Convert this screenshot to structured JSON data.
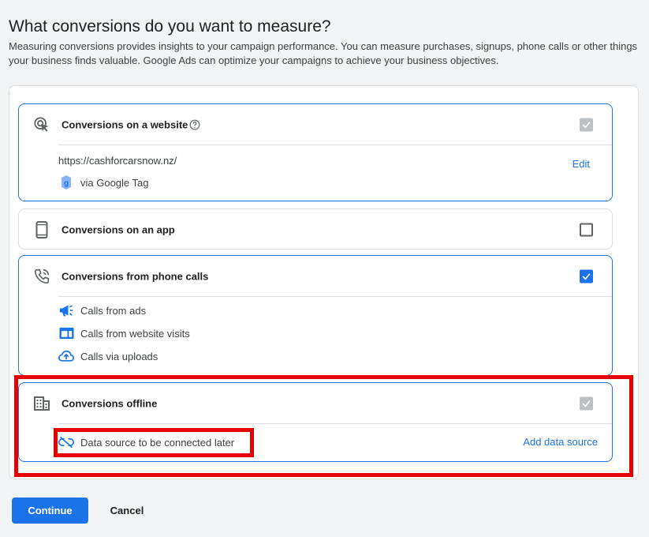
{
  "header": {
    "title": "What conversions do you want to measure?",
    "description": "Measuring conversions provides insights to your campaign performance. You can measure purchases, signups, phone calls or other things your business finds valuable. Google Ads can optimize your campaigns to achieve your business objectives."
  },
  "cards": {
    "website": {
      "title": "Conversions on a website",
      "url": "https://cashforcarsnow.nz/",
      "tag_label": "via Google Tag",
      "edit_label": "Edit",
      "checkbox_state": "checked-disabled"
    },
    "app": {
      "title": "Conversions on an app",
      "checkbox_state": "unchecked"
    },
    "phone": {
      "title": "Conversions from phone calls",
      "checkbox_state": "checked",
      "items": [
        "Calls from ads",
        "Calls from website visits",
        "Calls via uploads"
      ]
    },
    "offline": {
      "title": "Conversions offline",
      "checkbox_state": "checked-disabled",
      "source_label": "Data source to be connected later",
      "add_source_label": "Add data source"
    }
  },
  "actions": {
    "continue_label": "Continue",
    "cancel_label": "Cancel"
  },
  "colors": {
    "accent": "#1a73e8",
    "highlight": "#e50000",
    "disabled_check": "#bdc1c6"
  },
  "icons": {
    "website": "cursor-click-icon",
    "help": "help-circle-icon",
    "google_tag": "google-tag-icon",
    "app": "smartphone-icon",
    "phone": "phone-call-icon",
    "calls_ads": "megaphone-icon",
    "calls_website": "web-window-icon",
    "calls_uploads": "cloud-upload-icon",
    "offline": "building-icon",
    "unlink": "link-off-icon"
  }
}
